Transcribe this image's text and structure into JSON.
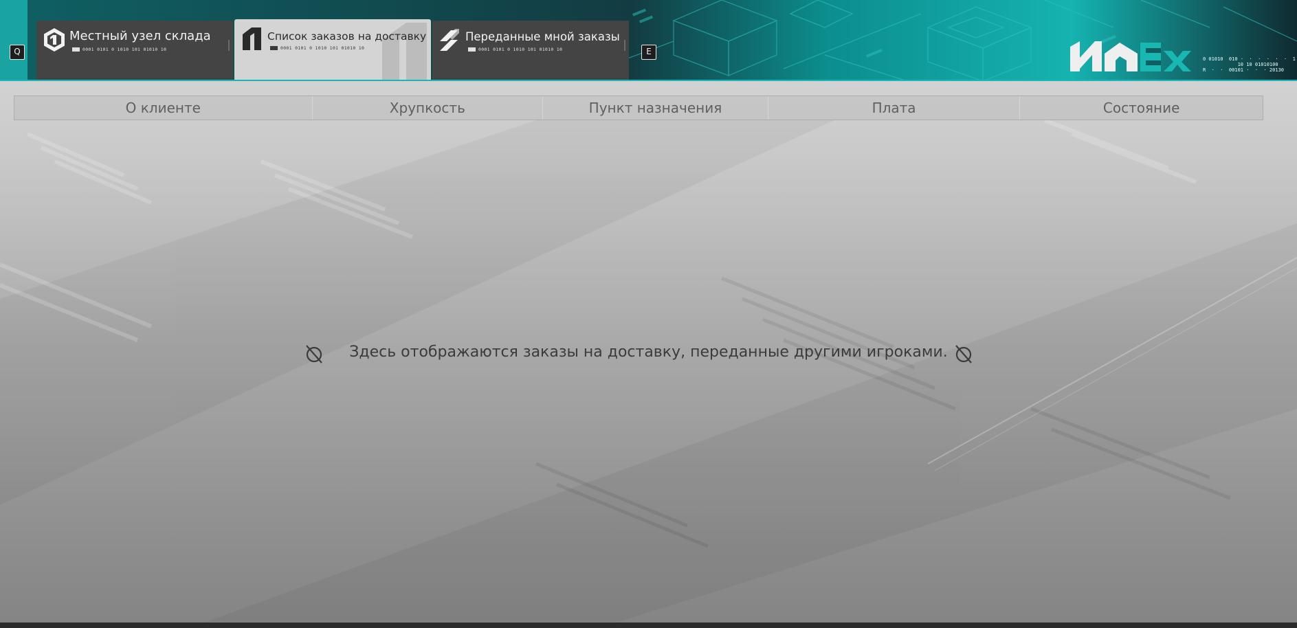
{
  "keys": {
    "prev": "Q",
    "next": "E"
  },
  "tabs": [
    {
      "title": "Местный узел склада",
      "code": "0001  0101 0 1010 101 01010 10",
      "icon": "cube-icon",
      "active": false
    },
    {
      "title": "Список заказов на доставку",
      "code": "0001  0101 0 1010 101 01010 10",
      "icon": "delivery-list-icon",
      "active": true
    },
    {
      "title": "Переданные мной заказы",
      "code": "0001  0101 0 1010 101 01010 10",
      "icon": "shared-orders-icon",
      "active": false
    }
  ],
  "logo": {
    "name": "logo-icon",
    "code_lines": [
      "0 01010  010 ·  ·  ·  ·  ·  ·  1",
      "            10 10 01010100",
      "R  ·  ·  00101 ·  ·  · 20130"
    ]
  },
  "columns": [
    "О клиенте",
    "Хрупкость",
    "Пункт назначения",
    "Плата",
    "Состояние"
  ],
  "empty_message": "Здесь отображаются заказы на доставку, переданные другими игроками.",
  "colors": {
    "accent": "#1aa3a3",
    "header_dark": "#123c42",
    "tab_inactive": "#444444",
    "tab_active": "#d4d4d4",
    "text_dark": "#3b3b3b"
  }
}
